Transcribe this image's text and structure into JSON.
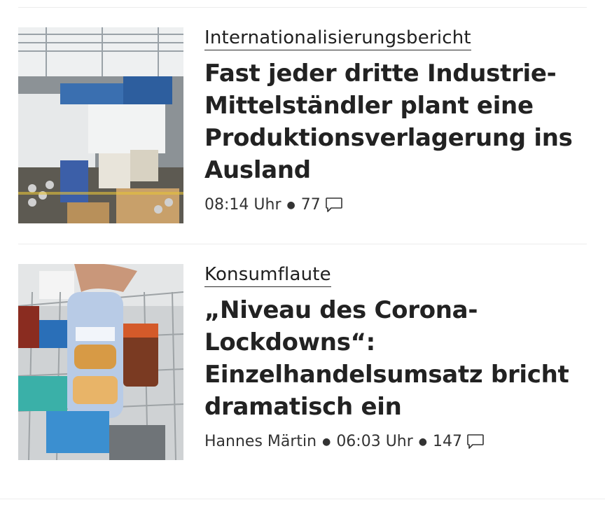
{
  "articles": [
    {
      "kicker": "Internationalisierungsbericht",
      "headline": "Fast jeder dritte Industrie-Mittelständler plant eine Produktionsverlagerung ins Ausland",
      "author": "",
      "time": "08:14 Uhr",
      "comments": "77",
      "image": "factory-hall-photo"
    },
    {
      "kicker": "Konsumflaute",
      "headline": "„Niveau des Corona-Lockdowns“: Einzelhandelsumsatz bricht dramatisch ein",
      "author": "Hannes Märtin",
      "time": "06:03 Uhr",
      "comments": "147",
      "image": "shopping-cart-photo"
    }
  ],
  "icons": {
    "comment": "comment-bubble-icon"
  },
  "colors": {
    "text": "#222222",
    "divider": "#ececec"
  }
}
